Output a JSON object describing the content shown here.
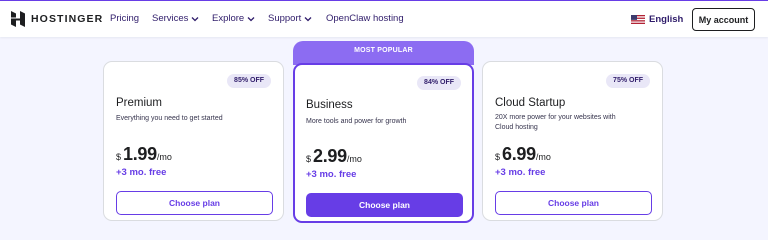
{
  "brand": {
    "name": "HOSTINGER"
  },
  "nav": {
    "items": [
      {
        "label": "Pricing",
        "has_dropdown": false
      },
      {
        "label": "Services",
        "has_dropdown": true
      },
      {
        "label": "Explore",
        "has_dropdown": true
      },
      {
        "label": "Support",
        "has_dropdown": true
      },
      {
        "label": "OpenClaw hosting",
        "has_dropdown": false
      }
    ],
    "language": "English",
    "language_icon": "us-flag-icon",
    "account_label": "My account"
  },
  "plans": [
    {
      "name": "Premium",
      "badge": "85% OFF",
      "description": "Everything you need to get started",
      "currency": "$",
      "price": "1.99",
      "period": "/mo",
      "free": "+3 mo. free",
      "cta": "Choose plan",
      "featured": false
    },
    {
      "name": "Business",
      "badge": "84% OFF",
      "description": "More tools and power for growth",
      "currency": "$",
      "price": "2.99",
      "period": "/mo",
      "free": "+3 mo. free",
      "cta": "Choose plan",
      "featured": true,
      "featured_label": "MOST POPULAR"
    },
    {
      "name": "Cloud Startup",
      "badge": "75% OFF",
      "description": "20X more power for your websites with Cloud hosting",
      "currency": "$",
      "price": "6.99",
      "period": "/mo",
      "free": "+3 mo. free",
      "cta": "Choose plan",
      "featured": false
    }
  ],
  "colors": {
    "accent": "#673de6",
    "accent_light": "#8c6cf2",
    "badge_bg": "#e9e7f7",
    "text": "#1d1e20",
    "page_bg": "#f4f5ff"
  }
}
